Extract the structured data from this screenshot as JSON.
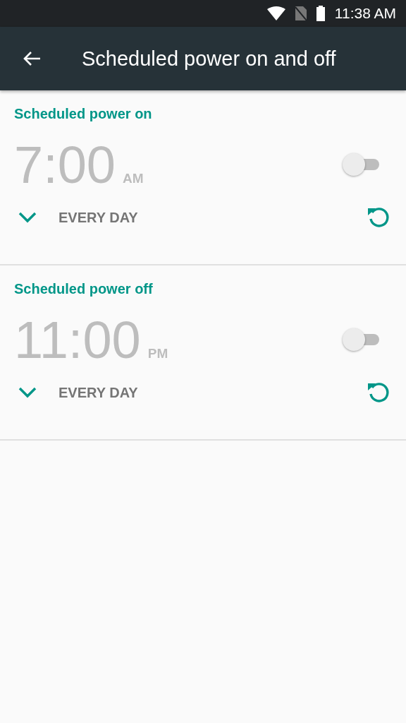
{
  "status_bar": {
    "time": "11:38 AM"
  },
  "app_bar": {
    "title": "Scheduled power on and off"
  },
  "schedules": [
    {
      "title": "Scheduled power on",
      "time": "7:00",
      "period": "AM",
      "on": false,
      "repeat": "EVERY DAY"
    },
    {
      "title": "Scheduled power off",
      "time": "11:00",
      "period": "PM",
      "on": false,
      "repeat": "EVERY DAY"
    }
  ]
}
